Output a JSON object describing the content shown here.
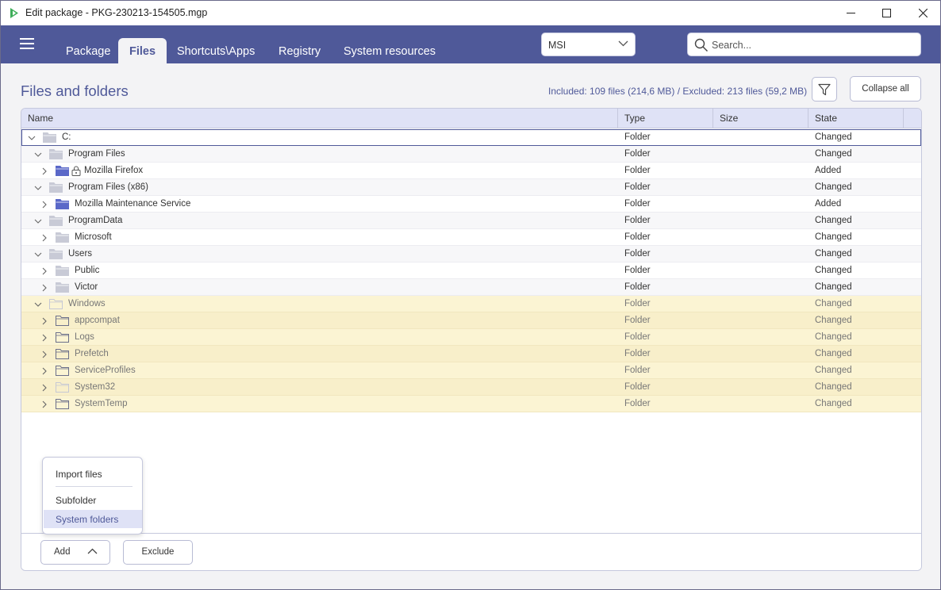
{
  "window": {
    "title": "Edit package - PKG-230213-154505.mgp"
  },
  "nav": {
    "tabs": [
      {
        "label": "Package"
      },
      {
        "label": "Files"
      },
      {
        "label": "Shortcuts\\Apps"
      },
      {
        "label": "Registry"
      },
      {
        "label": "System resources"
      }
    ],
    "active_tab": "Files",
    "format_select": "MSI",
    "search_placeholder": "Search..."
  },
  "header": {
    "title": "Files and folders",
    "summary": "Included: 109 files (214,6 MB) / Excluded: 213 files (59,2 MB)",
    "collapse_label": "Collapse all"
  },
  "table": {
    "columns": [
      "Name",
      "Type",
      "Size",
      "State"
    ],
    "rows": [
      {
        "name": "C:",
        "type": "Folder",
        "state": "Changed",
        "depth": 0,
        "expanded": true,
        "folder": "gray",
        "lock": false,
        "system": false
      },
      {
        "name": "Program Files",
        "type": "Folder",
        "state": "Changed",
        "depth": 1,
        "expanded": true,
        "folder": "gray",
        "lock": false,
        "system": false
      },
      {
        "name": "Mozilla Firefox",
        "type": "Folder",
        "state": "Added",
        "depth": 2,
        "expanded": false,
        "folder": "blue",
        "lock": true,
        "system": false
      },
      {
        "name": "Program Files (x86)",
        "type": "Folder",
        "state": "Changed",
        "depth": 1,
        "expanded": true,
        "folder": "gray",
        "lock": false,
        "system": false
      },
      {
        "name": "Mozilla Maintenance Service",
        "type": "Folder",
        "state": "Added",
        "depth": 2,
        "expanded": false,
        "folder": "blue",
        "lock": false,
        "system": false
      },
      {
        "name": "ProgramData",
        "type": "Folder",
        "state": "Changed",
        "depth": 1,
        "expanded": true,
        "folder": "gray",
        "lock": false,
        "system": false
      },
      {
        "name": "Microsoft",
        "type": "Folder",
        "state": "Changed",
        "depth": 2,
        "expanded": false,
        "folder": "gray",
        "lock": false,
        "system": false
      },
      {
        "name": "Users",
        "type": "Folder",
        "state": "Changed",
        "depth": 1,
        "expanded": true,
        "folder": "gray",
        "lock": false,
        "system": false
      },
      {
        "name": "Public",
        "type": "Folder",
        "state": "Changed",
        "depth": 2,
        "expanded": false,
        "folder": "gray",
        "lock": false,
        "system": false
      },
      {
        "name": "Victor",
        "type": "Folder",
        "state": "Changed",
        "depth": 2,
        "expanded": false,
        "folder": "gray",
        "lock": false,
        "system": false
      },
      {
        "name": "Windows",
        "type": "Folder",
        "state": "Changed",
        "depth": 1,
        "expanded": true,
        "folder": "outline-light",
        "lock": false,
        "system": true
      },
      {
        "name": "appcompat",
        "type": "Folder",
        "state": "Changed",
        "depth": 2,
        "expanded": false,
        "folder": "outline",
        "lock": false,
        "system": true
      },
      {
        "name": "Logs",
        "type": "Folder",
        "state": "Changed",
        "depth": 2,
        "expanded": false,
        "folder": "outline",
        "lock": false,
        "system": true
      },
      {
        "name": "Prefetch",
        "type": "Folder",
        "state": "Changed",
        "depth": 2,
        "expanded": false,
        "folder": "outline",
        "lock": false,
        "system": true
      },
      {
        "name": "ServiceProfiles",
        "type": "Folder",
        "state": "Changed",
        "depth": 2,
        "expanded": false,
        "folder": "outline",
        "lock": false,
        "system": true
      },
      {
        "name": "System32",
        "type": "Folder",
        "state": "Changed",
        "depth": 2,
        "expanded": false,
        "folder": "outline-light",
        "lock": false,
        "system": true
      },
      {
        "name": "SystemTemp",
        "type": "Folder",
        "state": "Changed",
        "depth": 2,
        "expanded": false,
        "folder": "outline",
        "lock": false,
        "system": true
      }
    ]
  },
  "footer": {
    "add_label": "Add",
    "exclude_label": "Exclude"
  },
  "add_menu": {
    "items": [
      "Import files",
      "Subfolder",
      "System folders"
    ],
    "highlighted": "System folders"
  },
  "colors": {
    "brand": "#4f5999",
    "header_bg": "#dfe2f6",
    "system_row_bg": "#fbf4d3",
    "folder_blue": "#5a68c8",
    "folder_gray": "#c8cad6"
  }
}
